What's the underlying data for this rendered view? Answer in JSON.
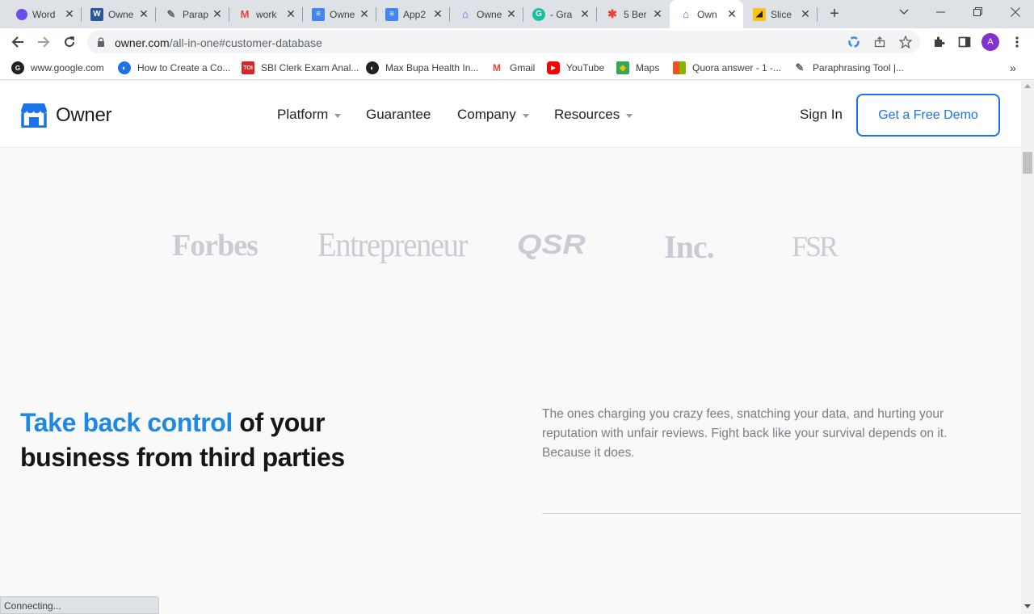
{
  "tabs": [
    {
      "title": "Word",
      "icon": "word-icon",
      "fav_text": "",
      "fav_color": "#6a4ee6"
    },
    {
      "title": "Owne",
      "icon": "ms-word-icon",
      "fav_text": "W",
      "fav_color": "#2b579a"
    },
    {
      "title": "Parap",
      "icon": "quill-icon",
      "fav_text": "✎",
      "fav_color": "transparent"
    },
    {
      "title": "work",
      "icon": "gmail-icon",
      "fav_text": "M",
      "fav_color": "transparent"
    },
    {
      "title": "Owne",
      "icon": "google-docs-icon",
      "fav_text": "≡",
      "fav_color": "#4285f4"
    },
    {
      "title": "App2",
      "icon": "google-docs-icon",
      "fav_text": "≡",
      "fav_color": "#4285f4"
    },
    {
      "title": "Owne",
      "icon": "owner-store-icon",
      "fav_text": "⌂",
      "fav_color": "transparent"
    },
    {
      "title": "- Gra",
      "icon": "grammarly-icon",
      "fav_text": "G",
      "fav_color": "#15c39a"
    },
    {
      "title": "5 Ber",
      "icon": "asterisk-icon",
      "fav_text": "✱",
      "fav_color": "transparent"
    },
    {
      "title": "Own",
      "icon": "owner-store-icon",
      "fav_text": "⌂",
      "fav_color": "transparent"
    },
    {
      "title": "Slice",
      "icon": "slice-icon",
      "fav_text": "◢",
      "fav_color": "#f5c518"
    }
  ],
  "address_bar": {
    "host": "owner.com",
    "path": "/all-in-one#customer-database"
  },
  "bookmarks": [
    {
      "label": "www.google.com",
      "icon": "google-icon"
    },
    {
      "label": "How to Create a Co...",
      "icon": "globe-icon"
    },
    {
      "label": "SBI Clerk Exam Anal...",
      "icon": "toi-icon"
    },
    {
      "label": "Max Bupa Health In...",
      "icon": "globe-icon"
    },
    {
      "label": "Gmail",
      "icon": "gmail-icon"
    },
    {
      "label": "YouTube",
      "icon": "youtube-icon"
    },
    {
      "label": "Maps",
      "icon": "maps-icon"
    },
    {
      "label": "Quora answer - 1 -...",
      "icon": "office-icon"
    },
    {
      "label": "Paraphrasing Tool |...",
      "icon": "quill-icon"
    }
  ],
  "site": {
    "logo_text": "Owner",
    "nav": [
      {
        "label": "Platform",
        "has_dropdown": true
      },
      {
        "label": "Guarantee",
        "has_dropdown": false
      },
      {
        "label": "Company",
        "has_dropdown": true
      },
      {
        "label": "Resources",
        "has_dropdown": true
      }
    ],
    "sign_in": "Sign In",
    "cta": "Get a Free Demo",
    "press_logos": [
      "Forbes",
      "Entrepreneur",
      "QSR",
      "Inc.",
      "FSR"
    ],
    "headline_accent": "Take back control",
    "headline_rest": " of your business from third parties",
    "subtext": "The ones charging you crazy fees, snatching your data, and hurting your reputation with unfair reviews. Fight back like your survival depends on it. Because it does."
  },
  "status_text": "Connecting...",
  "colors": {
    "accent": "#1e88e5",
    "cta_border": "#1a73e8",
    "press_logo": "#c9ccd4",
    "avatar": "#8430ce"
  },
  "profile_initial": "A"
}
